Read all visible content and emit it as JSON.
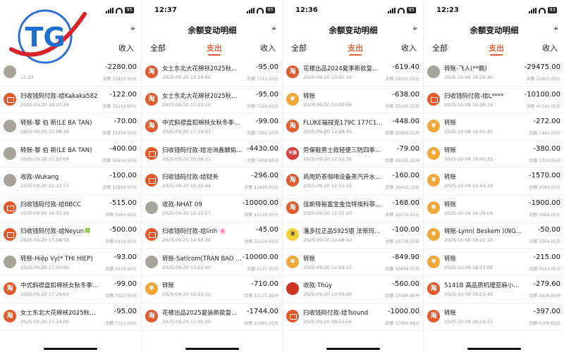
{
  "logo_text": "TG",
  "panels": [
    {
      "time": "",
      "battery": "95",
      "title": "",
      "tabs": {
        "all": "",
        "out": "",
        "in": "收入"
      },
      "rows": [
        {
          "icon": "person-avatar",
          "name": "",
          "time": "12:23",
          "amount": "-2280.00",
          "balance": "余额 12932.93元"
        },
        {
          "icon": "scan-pay-icon",
          "name": "扫收钱码付款-给Kakaka582",
          "time": "2025-09-20 10:27:29",
          "amount": "-122.00",
          "balance": "余额 15212.93元"
        },
        {
          "icon": "person-avatar",
          "name": "转账-黎 伯 新(LE BA TAN)",
          "time": "2025-09-20 22:58:39",
          "amount": "-70.00",
          "balance": "余额 15334.93元"
        },
        {
          "icon": "person-avatar",
          "name": "转账-黎 伯 新(LE BA TAN)",
          "time": "2025-09-20 22:57:09",
          "amount": "-400.00",
          "balance": "余额 15404.93元"
        },
        {
          "icon": "person-avatar",
          "name": "收款-Wukang",
          "time": "2025-09-20 22:12:57",
          "amount": "-100.00",
          "balance": "余额 15804.93元"
        },
        {
          "icon": "scan-pay-icon",
          "name": "扫收钱码付款-给BBCC",
          "time": "2025-09-20 18:52:29",
          "amount": "-515.00",
          "balance": "余额 5904.93元"
        },
        {
          "icon": "scan-pay-icon",
          "name": "扫收钱码付款-给Neyun🍀",
          "time": "2025-09-20 17:58:58",
          "amount": "-500.00",
          "balance": "余额 6419.93元"
        },
        {
          "icon": "person-avatar",
          "name": "转账-Hiệp Vy(* THI HIEP)",
          "time": "2025-09-20 17:30:06",
          "amount": "-93.00",
          "balance": "余额 6919.93元"
        },
        {
          "icon": "taobao-icon",
          "name": "中式斜襟盘扣棉袄女秋冬季新款…",
          "time": "2025-09-20 17:29:04",
          "amount": "-99.00",
          "balance": "余额 7012.93元"
        },
        {
          "icon": "taobao-icon",
          "name": "女士东北大花棉袄2025秋冬新款…",
          "time": "2025-09-20 17:24:06",
          "amount": "-95.00",
          "balance": "余额 7111.93元"
        }
      ]
    },
    {
      "time": "12:37",
      "battery": "95",
      "title": "余额变动明细",
      "tabs": {
        "all": "全部",
        "out": "支出",
        "in": "收入"
      },
      "rows": [
        {
          "icon": "taobao-icon",
          "name": "女士东北大花棉袄2025秋冬新款…",
          "time": "2025-09-20 17:24:06",
          "amount": "-95.00",
          "balance": "余额 7111.93元"
        },
        {
          "icon": "taobao-icon",
          "name": "女士东北大花棉袄2025秋冬新款…",
          "time": "2025-09-20 17:23:19",
          "amount": "-95.00",
          "balance": "余额 7206.93元"
        },
        {
          "icon": "taobao-icon",
          "name": "中式斜襟盘扣棉袄女秋冬季新款…",
          "time": "2025-09-20 17:19:47",
          "amount": "-99.00",
          "balance": "余额 7301.93元"
        },
        {
          "icon": "scan-pay-icon",
          "name": "扫收钱码付款-给沧洲鑫麒佑…",
          "time": "2025-09-20 16:38:31",
          "amount": "-4430.00",
          "balance": "余额 7400.93元"
        },
        {
          "icon": "scan-pay-icon",
          "name": "扫收钱码付款-给财务",
          "time": "2025-09-20 16:35:44",
          "amount": "-296.00",
          "balance": "余额 11830.93元"
        },
        {
          "icon": "person-avatar",
          "name": "收款-NHAT 09",
          "time": "2025-09-20 16:21:27",
          "amount": "-10000.00",
          "balance": "余额 12126.93元"
        },
        {
          "icon": "scan-pay-icon",
          "name": "扫收钱码付款-给linh 🌸",
          "time": "2025-09-20 14:58:39",
          "amount": "-45.00",
          "balance": "余额 22126.93元"
        },
        {
          "icon": "person-avatar",
          "name": "转账-Satlcom(TRAN BAO …",
          "time": "2025-09-20 13:21:40",
          "amount": "-10000.00",
          "balance": "余额 2171.93元"
        },
        {
          "icon": "yuan-icon",
          "name": "转账",
          "time": "2025-09-20 13:15:52",
          "amount": "-710.00",
          "balance": "余额 12171.93元"
        },
        {
          "icon": "taobao-icon",
          "name": "花楼出品2025夏装新款复古…",
          "time": "2025-09-20 13:02:20",
          "amount": "-1744.00",
          "balance": "余额 12881.93元"
        }
      ]
    },
    {
      "time": "12:36",
      "battery": "95",
      "title": "余额变动明细",
      "tabs": {
        "all": "全部",
        "out": "支出",
        "in": "收入"
      },
      "rows": [
        {
          "icon": "taobao-icon",
          "name": "花楼出品2024夏季新款复古小…",
          "time": "2025-09-20 13:01:16",
          "amount": "-619.40",
          "balance": "余额 14625.93元"
        },
        {
          "icon": "yuan-icon",
          "name": "转账",
          "time": "2025-09-20 13:00:06",
          "amount": "-638.00",
          "balance": "余额 15245.33元"
        },
        {
          "icon": "taobao-icon",
          "name": "FLUKE福禄克179C 177C175C…",
          "time": "2025-09-20 12:58:43",
          "amount": "-448.00",
          "balance": "余额 15883.33元"
        },
        {
          "icon": "store-icon",
          "name": "劳保鞋男士款轻便三防四季女老…",
          "time": "2025-09-20 12:52:30",
          "amount": "-79.00",
          "balance": "余额 16331.33元"
        },
        {
          "icon": "taobao-icon",
          "name": "商用奶茶咖啡设备蒸汽开水奶…",
          "time": "2025-09-20 12:51:15",
          "amount": "-160.00",
          "balance": "余额 16410.33元"
        },
        {
          "icon": "taobao-icon",
          "name": "佳斯特裕富宝金信特埃科菲玛…",
          "time": "2025-09-20 12:51:05",
          "amount": "-168.00",
          "balance": "余额 16570.33元"
        },
        {
          "icon": "shop-icon",
          "name": "潘多拉正品S925银 法蒂玛之手…",
          "time": "2025-09-20 12:48:42",
          "amount": "-100.00",
          "balance": "余额 16738.33元"
        },
        {
          "icon": "yuan-icon",
          "name": "转账",
          "time": "2025-09-20 12:03:15",
          "amount": "-849.90",
          "balance": "余额 16838.33元"
        },
        {
          "icon": "cup-icon",
          "name": "收款-Thủy",
          "time": "2025-09-20 10:09:38",
          "amount": "-560.00",
          "balance": "余额 17434.88元"
        },
        {
          "icon": "scan-pay-icon",
          "name": "扫收钱码付款-给Tsound",
          "time": "2025-09-20 08:51:56",
          "amount": "-1000.00",
          "balance": "余额 17994.88元"
        }
      ]
    },
    {
      "time": "12:23",
      "battery": "93",
      "title": "余额变动明细",
      "tabs": {
        "all": "全部",
        "out": "支出",
        "in": "收入"
      },
      "rows": [
        {
          "icon": "person-avatar",
          "name": "转账-飞人(**鹏)",
          "time": "2025-10-08 18:28:40",
          "amount": "-29475.00",
          "balance": "余额 11867.05元"
        },
        {
          "icon": "scan-pay-icon",
          "name": "扫收钱码付款-给L****",
          "time": "2025-10-08 18:25:18",
          "amount": "-10100.00",
          "balance": "余额 41342.05元"
        },
        {
          "icon": "yuan-icon",
          "name": "转账",
          "time": "2025-10-08 18:01:41",
          "amount": "-272.00",
          "balance": "余额 1442.05元"
        },
        {
          "icon": "yuan-icon",
          "name": "转账",
          "time": "2025-10-08 18:45:33",
          "amount": "-380.00",
          "balance": "余额 1714.05元"
        },
        {
          "icon": "yuan-icon",
          "name": "转账",
          "time": "2025-10-08 18:44:18",
          "amount": "-1570.00",
          "balance": "余额 2094.05元"
        },
        {
          "icon": "yuan-icon",
          "name": "转账",
          "time": "2025-10-08 18:29:04",
          "amount": "-1900.00",
          "balance": "余额 3664.05元"
        },
        {
          "icon": "yuan-icon",
          "name": "转账-Lynn( Beskem )(NGUYEN…",
          "time": "2025-10-08 18:21:18",
          "amount": "-50.00",
          "balance": "余额 5564.05元"
        },
        {
          "icon": "yuan-icon",
          "name": "转账",
          "time": "2025-10-08 18:17:08",
          "amount": "-215.00",
          "balance": "余额 5614.05元"
        },
        {
          "icon": "taobao-icon",
          "name": "5141B 高品质机理亚麻小飞袖…",
          "time": "2025-10-08 18:15:45",
          "amount": "-279.60",
          "balance": "余额 5829.05元"
        },
        {
          "icon": "taobao-icon",
          "name": "转账",
          "time": "2025-10-08 18:14:15",
          "amount": "-397.00",
          "balance": "余额 6108.65元"
        }
      ]
    }
  ]
}
